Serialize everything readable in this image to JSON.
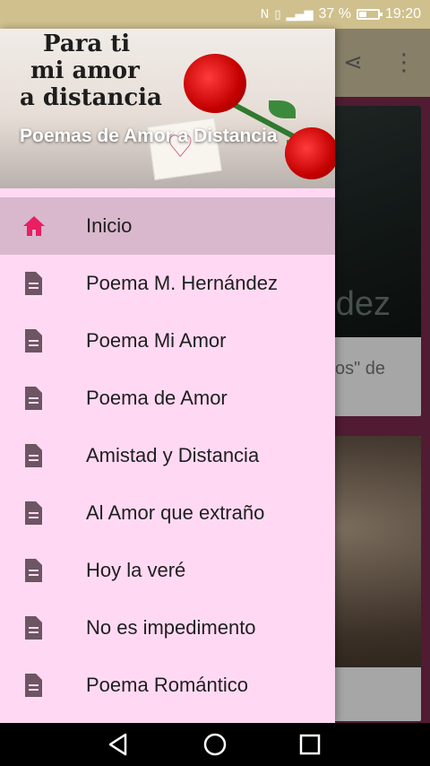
{
  "status_bar": {
    "battery_percent": "37 %",
    "battery_level": 0.37,
    "time": "19:20",
    "icons": [
      "nfc-icon",
      "vibrate-icon",
      "signal-4g-icon",
      "battery-icon"
    ]
  },
  "app": {
    "toolbar_icons": [
      "share-icon",
      "more-vert-icon"
    ],
    "card1_title_fragment": "dez",
    "card1_text_fragment": "os\" de"
  },
  "drawer": {
    "header_image_lines": [
      "Para ti",
      "mi amor",
      "a distancia"
    ],
    "header_title": "Poemas de Amor a Distancia",
    "active_color": "#e91e63",
    "icon_color": "#6d5563",
    "items": [
      {
        "label": "Inicio",
        "icon": "home-icon",
        "active": true
      },
      {
        "label": "Poema M. Hernández",
        "icon": "document-icon",
        "active": false
      },
      {
        "label": "Poema Mi Amor",
        "icon": "document-icon",
        "active": false
      },
      {
        "label": "Poema de Amor",
        "icon": "document-icon",
        "active": false
      },
      {
        "label": "Amistad y Distancia",
        "icon": "document-icon",
        "active": false
      },
      {
        "label": "Al Amor que extraño",
        "icon": "document-icon",
        "active": false
      },
      {
        "label": "Hoy la veré",
        "icon": "document-icon",
        "active": false
      },
      {
        "label": "No es impedimento",
        "icon": "document-icon",
        "active": false
      },
      {
        "label": "Poema Romántico",
        "icon": "document-icon",
        "active": false
      }
    ]
  },
  "nav_bar": {
    "buttons": [
      "back-icon",
      "home-circle-icon",
      "recents-icon"
    ]
  }
}
